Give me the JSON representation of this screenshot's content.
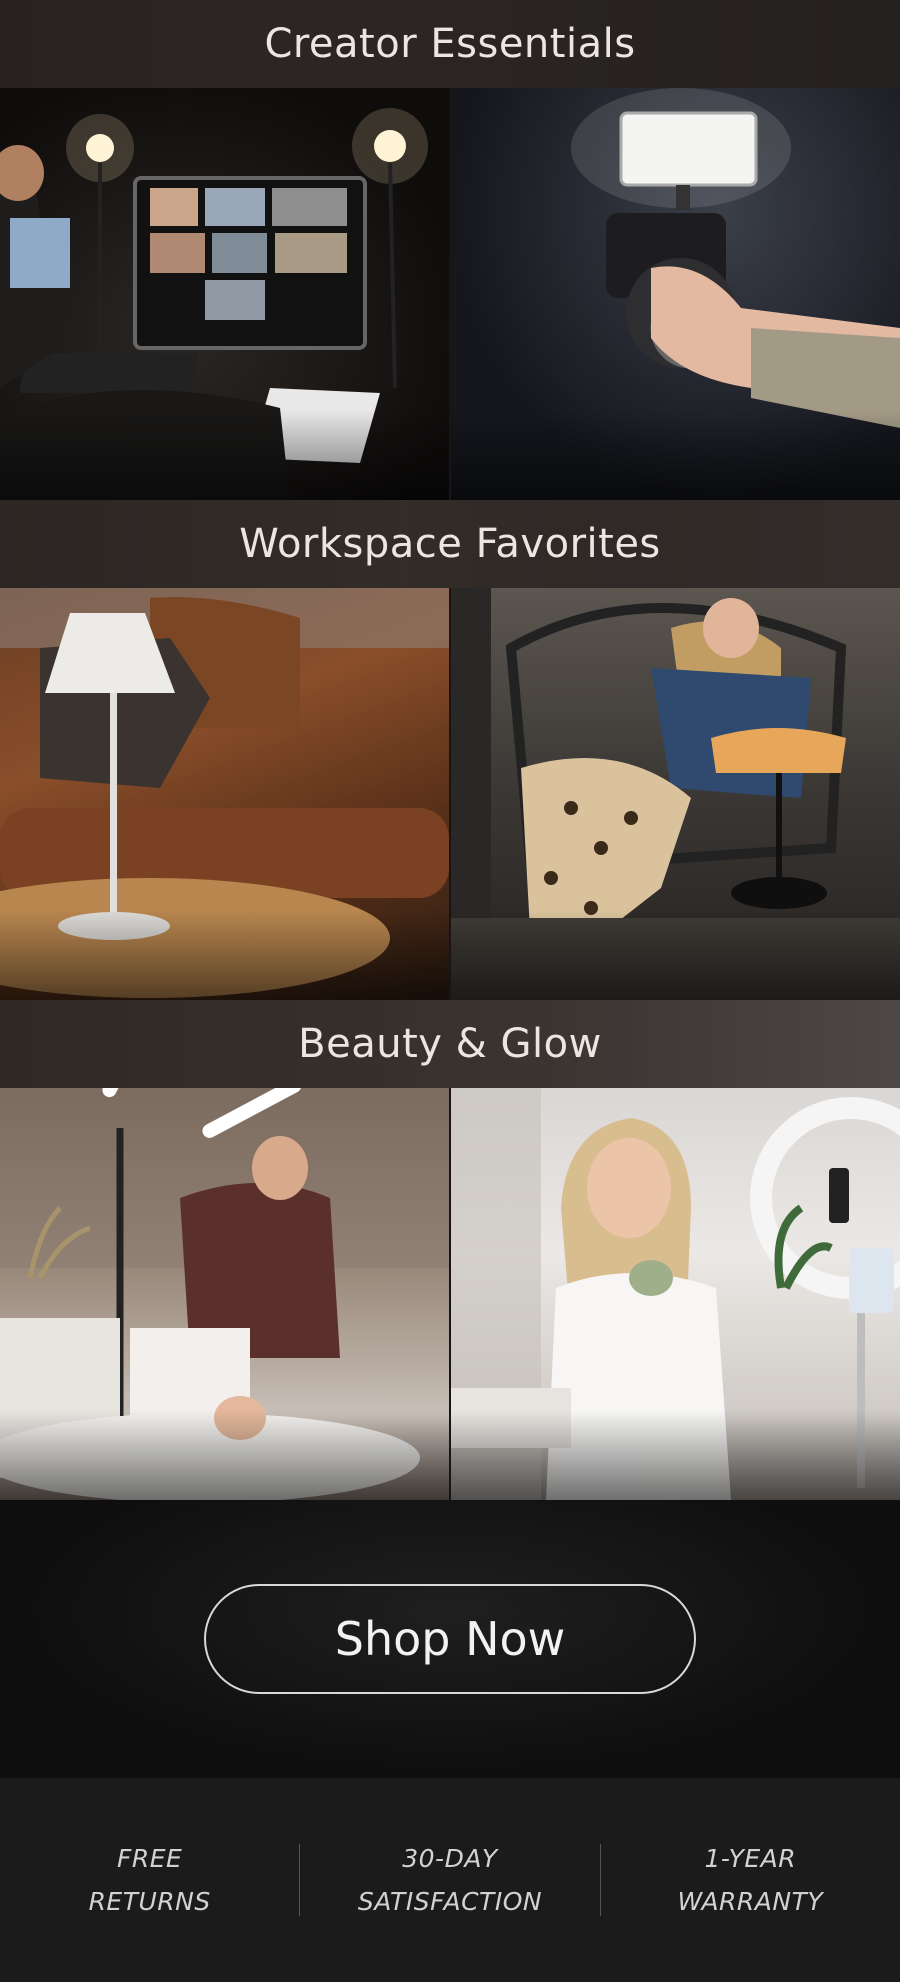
{
  "sections": [
    {
      "title": "Creator Essentials"
    },
    {
      "title": "Workspace Favorites"
    },
    {
      "title": "Beauty & Glow"
    }
  ],
  "cta": {
    "label": "Shop Now"
  },
  "perks": [
    {
      "line1": "FREE",
      "line2": "RETURNS"
    },
    {
      "line1": "30-DAY",
      "line2": "SATISFACTION"
    },
    {
      "line1": "1-YEAR",
      "line2": "WARRANTY"
    }
  ],
  "colors": {
    "page_bg": "#161616",
    "header_text": "#ece6e2",
    "button_border": "#d8d8d8",
    "footer_bg": "#1b1b1b"
  }
}
